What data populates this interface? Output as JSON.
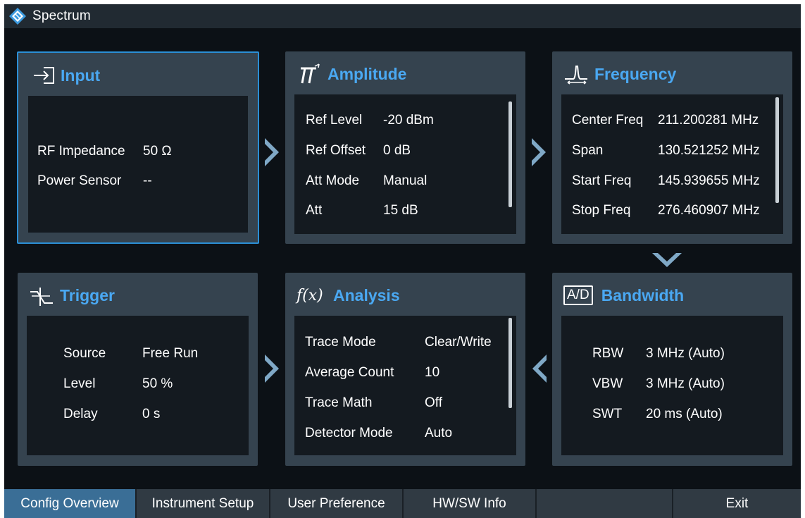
{
  "app": {
    "title": "Spectrum"
  },
  "panels": {
    "input": {
      "title": "Input",
      "rows": [
        {
          "label": "RF Impedance",
          "value": "50 Ω"
        },
        {
          "label": "Power Sensor",
          "value": "--"
        }
      ]
    },
    "amplitude": {
      "title": "Amplitude",
      "rows": [
        {
          "label": "Ref Level",
          "value": "-20 dBm"
        },
        {
          "label": "Ref Offset",
          "value": "0 dB"
        },
        {
          "label": "Att Mode",
          "value": "Manual"
        },
        {
          "label": "Att",
          "value": "15 dB"
        }
      ]
    },
    "frequency": {
      "title": "Frequency",
      "rows": [
        {
          "label": "Center Freq",
          "value": "211.200281 MHz"
        },
        {
          "label": "Span",
          "value": "130.521252 MHz"
        },
        {
          "label": "Start Freq",
          "value": "145.939655 MHz"
        },
        {
          "label": "Stop Freq",
          "value": "276.460907 MHz"
        }
      ]
    },
    "trigger": {
      "title": "Trigger",
      "rows": [
        {
          "label": "Source",
          "value": "Free Run"
        },
        {
          "label": "Level",
          "value": "50 %"
        },
        {
          "label": "Delay",
          "value": "0 s"
        }
      ]
    },
    "analysis": {
      "title": "Analysis",
      "icon_text": "f(x)",
      "rows": [
        {
          "label": "Trace Mode",
          "value": "Clear/Write"
        },
        {
          "label": "Average Count",
          "value": "10"
        },
        {
          "label": "Trace Math",
          "value": "Off"
        },
        {
          "label": "Detector Mode",
          "value": "Auto"
        }
      ]
    },
    "bandwidth": {
      "title": "Bandwidth",
      "icon_text": "A/D",
      "rows": [
        {
          "label": "RBW",
          "value": "3 MHz (Auto)"
        },
        {
          "label": "VBW",
          "value": "3 MHz (Auto)"
        },
        {
          "label": "SWT",
          "value": "20 ms (Auto)"
        }
      ]
    }
  },
  "tabs": [
    {
      "label": "Config Overview",
      "active": true
    },
    {
      "label": "Instrument Setup",
      "active": false
    },
    {
      "label": "User Preference",
      "active": false
    },
    {
      "label": "HW/SW Info",
      "active": false
    },
    {
      "label": "",
      "active": false
    },
    {
      "label": "Exit",
      "active": false
    }
  ],
  "colors": {
    "accent": "#4aa8f2",
    "selected_border": "#2b8fd6",
    "panel_bg": "#35434f",
    "body_bg": "#141a20",
    "active_tab": "#3a6e96",
    "arrow": "#7fa8c6"
  },
  "icons": {
    "logo": "rohde-schwarz-logo",
    "input": "input-arrow-icon",
    "amplitude": "amplitude-icon",
    "frequency": "frequency-peak-icon",
    "trigger": "trigger-icon",
    "analysis": "function-icon",
    "bandwidth": "ad-icon"
  }
}
